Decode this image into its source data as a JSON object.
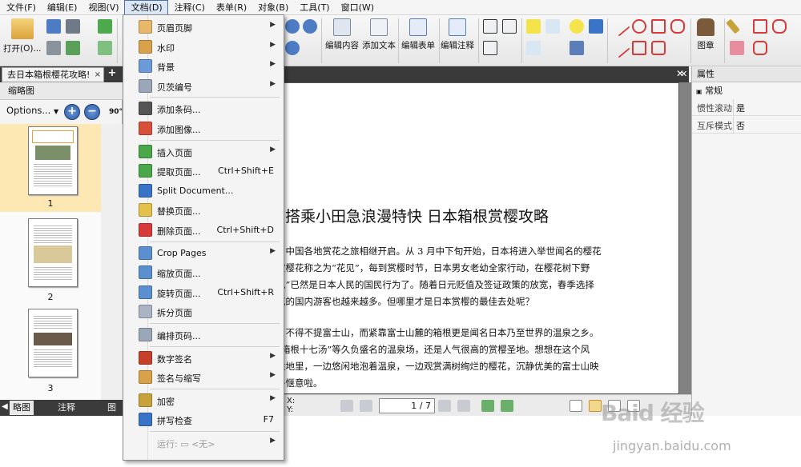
{
  "menubar": {
    "items": [
      "文件(F)",
      "编辑(E)",
      "视图(V)",
      "文档(D)",
      "注释(C)",
      "表单(R)",
      "对象(B)",
      "工具(T)",
      "窗口(W)"
    ],
    "active_index": 3
  },
  "toolbar": {
    "open_label": "打开(O)...",
    "edit_content_label": "编辑内容",
    "add_text_label": "添加文本",
    "edit_form_label": "编辑表单",
    "edit_annotation_label": "编辑注释",
    "stamp_label": "图章"
  },
  "tabs": {
    "doc_tab_title": "去日本箱根樱花攻略!",
    "close_glyph": "×",
    "add_glyph": "+",
    "strip_close_glyph": "✕"
  },
  "thumbnails": {
    "header": "缩略图",
    "options_label": "Options...",
    "zoom_in_glyph": "+",
    "zoom_out_glyph": "−",
    "rotate_label": "90°",
    "pages": [
      "1",
      "2",
      "3"
    ],
    "selected_index": 0
  },
  "panel_tabs": [
    "略图",
    "注释",
    "图层"
  ],
  "dropdown": {
    "items": [
      {
        "label": "页眉页脚",
        "shortcut": "",
        "submenu": true,
        "icon": "header-footer-icon",
        "color": "#e8b86a"
      },
      {
        "label": "水印",
        "shortcut": "",
        "submenu": true,
        "icon": "watermark-icon",
        "color": "#d9a24a"
      },
      {
        "label": "背景",
        "shortcut": "",
        "submenu": true,
        "icon": "background-icon",
        "color": "#6a9ad8"
      },
      {
        "label": "贝茨编号",
        "shortcut": "",
        "submenu": true,
        "icon": "bates-number-icon",
        "color": "#9aa7b8"
      },
      {
        "label": "添加条码...",
        "shortcut": "",
        "submenu": false,
        "icon": "barcode-icon",
        "color": "#555555"
      },
      {
        "label": "添加图像...",
        "shortcut": "",
        "submenu": false,
        "icon": "add-image-icon",
        "color": "#d9503a"
      },
      {
        "label": "插入页面",
        "shortcut": "",
        "submenu": true,
        "icon": "insert-page-icon",
        "color": "#4aa84a"
      },
      {
        "label": "提取页面...",
        "shortcut": "Ctrl+Shift+E",
        "submenu": false,
        "icon": "extract-page-icon",
        "color": "#4aa84a"
      },
      {
        "label": "Split Document...",
        "shortcut": "",
        "submenu": false,
        "icon": "split-document-icon",
        "color": "#3a74c8"
      },
      {
        "label": "替换页面...",
        "shortcut": "",
        "submenu": false,
        "icon": "replace-page-icon",
        "color": "#e3c14a"
      },
      {
        "label": "删除页面...",
        "shortcut": "Ctrl+Shift+D",
        "submenu": false,
        "icon": "delete-page-icon",
        "color": "#d83a3a"
      },
      {
        "label": "Crop Pages",
        "shortcut": "",
        "submenu": true,
        "icon": "crop-pages-icon",
        "color": "#5a8fd0"
      },
      {
        "label": "缩放页面...",
        "shortcut": "",
        "submenu": false,
        "icon": "scale-page-icon",
        "color": "#5a8fd0"
      },
      {
        "label": "旋转页面...",
        "shortcut": "Ctrl+Shift+R",
        "submenu": false,
        "icon": "rotate-page-icon",
        "color": "#5a8fd0"
      },
      {
        "label": "拆分页面",
        "shortcut": "",
        "submenu": false,
        "icon": "split-page-icon",
        "color": "#aab4c4"
      },
      {
        "label": "编排页码...",
        "shortcut": "",
        "submenu": false,
        "icon": "page-numbering-icon",
        "color": "#9aa7b8"
      },
      {
        "label": "数字签名",
        "shortcut": "",
        "submenu": true,
        "icon": "digital-signature-icon",
        "color": "#c8402a"
      },
      {
        "label": "签名与缩写",
        "shortcut": "",
        "submenu": true,
        "icon": "sign-initials-icon",
        "color": "#d9a24a"
      },
      {
        "label": "加密",
        "shortcut": "",
        "submenu": true,
        "icon": "encrypt-icon",
        "color": "#c8a23a"
      },
      {
        "label": "拼写检查",
        "shortcut": "F7",
        "submenu": false,
        "icon": "spell-check-icon",
        "color": "#3a74c8"
      },
      {
        "label": "运行: ▭ <无>",
        "shortcut": "",
        "submenu": true,
        "icon": "",
        "color": "",
        "disabled": true
      }
    ],
    "icon_labels": {
      "barcode": "▦",
      "spell": "ABC"
    },
    "separator_after": [
      3,
      5,
      10,
      14,
      15,
      17,
      19
    ]
  },
  "document": {
    "title": "搭乘小田急浪漫特快  日本箱根赏樱攻略",
    "paragraph1": [
      "，中国各地赏花之旅相继开启。从 3 月中下旬开始，日本将进入举世闻名的樱花",
      "赏樱花称之为“花见”，每到赏樱时节，日本男女老幼全家行动，在樱花树下野",
      "见”已然是日本人民的国民行为了。随着日元贬值及签证政策的放宽，春季选择",
      "花的国内游客也越来越多。但哪里才是日本赏樱的最佳去处呢？"
    ],
    "paragraph2": [
      "，不得不提富士山，而紧靠富士山麓的箱根更是闻名日本乃至世界的温泉之乡。",
      "“箱根十七汤”等久负盛名的温泉场，还是人气很高的赏樱圣地。想想在这个风",
      "胜地里，一边悠闲地泡着温泉，一边观赏满树绚烂的樱花，沉静优美的富士山映",
      "多惬意啦。"
    ]
  },
  "navigation": {
    "x_label": "X:",
    "y_label": "Y:",
    "page_value": "1 / 7"
  },
  "properties": {
    "title": "属性",
    "close_glyph": "✕",
    "section": "常规",
    "rows": [
      {
        "key": "惯性滚动",
        "value": "是"
      },
      {
        "key": "互斥模式",
        "value": "否"
      }
    ]
  },
  "watermark": {
    "logo": "Baid 经验",
    "url": "jingyan.baidu.com"
  }
}
